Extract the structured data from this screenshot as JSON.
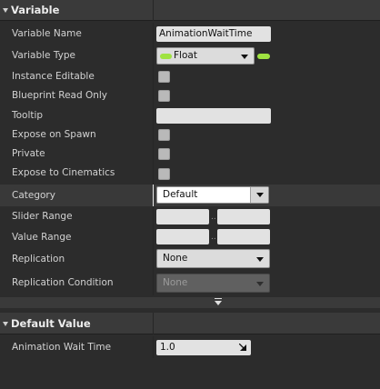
{
  "sections": {
    "variable": {
      "title": "Variable"
    },
    "default_value": {
      "title": "Default Value"
    }
  },
  "rows": {
    "variable_name": {
      "label": "Variable Name",
      "value": "AnimationWaitTime"
    },
    "variable_type": {
      "label": "Variable Type",
      "value": "Float",
      "type_color": "#9fe341"
    },
    "instance_editable": {
      "label": "Instance Editable"
    },
    "blueprint_read_only": {
      "label": "Blueprint Read Only"
    },
    "tooltip": {
      "label": "Tooltip",
      "value": ""
    },
    "expose_on_spawn": {
      "label": "Expose on Spawn"
    },
    "private": {
      "label": "Private"
    },
    "expose_to_cinematics": {
      "label": "Expose to Cinematics"
    },
    "category": {
      "label": "Category",
      "value": "Default"
    },
    "slider_range": {
      "label": "Slider Range",
      "min": "",
      "max": ""
    },
    "value_range": {
      "label": "Value Range",
      "min": "",
      "max": ""
    },
    "replication": {
      "label": "Replication",
      "value": "None"
    },
    "replication_condition": {
      "label": "Replication Condition",
      "value": "None"
    },
    "animation_wait_time": {
      "label": "Animation Wait Time",
      "value": "1.0"
    }
  },
  "icons": {
    "section_collapse": "chevron-down-icon",
    "advanced_expander": "expand-down-icon",
    "resize": "resize-arrow-icon",
    "dropdown": "chevron-down-icon"
  }
}
